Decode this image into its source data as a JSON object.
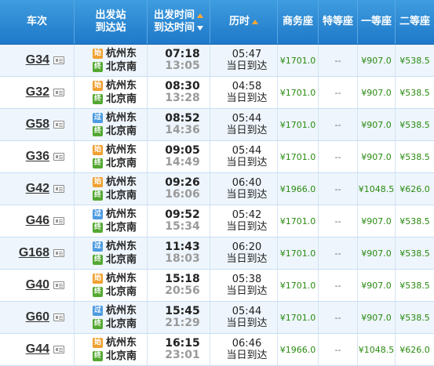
{
  "header": {
    "train": "车次",
    "station_top": "出发站",
    "station_bottom": "到达站",
    "time_top": "出发时间",
    "time_bottom": "到达时间",
    "duration": "历时",
    "business": "商务座",
    "special": "特等座",
    "first": "一等座",
    "second": "二等座"
  },
  "badge_labels": {
    "start": "始",
    "pass": "过",
    "end": "终"
  },
  "colors": {
    "header_blue": "#1e78c8",
    "price_green": "#2a8a12",
    "sort_arrow": "#ffa733"
  },
  "trains": [
    {
      "no": "G34",
      "from": "杭州东",
      "from_type": "start",
      "to": "北京南",
      "dep": "07:18",
      "arr": "13:05",
      "dur": "05:47",
      "day": "当日到达",
      "business": "¥1701.0",
      "special": "--",
      "first": "¥907.0",
      "second": "¥538.5"
    },
    {
      "no": "G32",
      "from": "杭州东",
      "from_type": "start",
      "to": "北京南",
      "dep": "08:30",
      "arr": "13:28",
      "dur": "04:58",
      "day": "当日到达",
      "business": "¥1701.0",
      "special": "--",
      "first": "¥907.0",
      "second": "¥538.5"
    },
    {
      "no": "G58",
      "from": "杭州东",
      "from_type": "pass",
      "to": "北京南",
      "dep": "08:52",
      "arr": "14:36",
      "dur": "05:44",
      "day": "当日到达",
      "business": "¥1701.0",
      "special": "--",
      "first": "¥907.0",
      "second": "¥538.5"
    },
    {
      "no": "G36",
      "from": "杭州东",
      "from_type": "start",
      "to": "北京南",
      "dep": "09:05",
      "arr": "14:49",
      "dur": "05:44",
      "day": "当日到达",
      "business": "¥1701.0",
      "special": "--",
      "first": "¥907.0",
      "second": "¥538.5"
    },
    {
      "no": "G42",
      "from": "杭州东",
      "from_type": "start",
      "to": "北京南",
      "dep": "09:26",
      "arr": "16:06",
      "dur": "06:40",
      "day": "当日到达",
      "business": "¥1966.0",
      "special": "--",
      "first": "¥1048.5",
      "second": "¥626.0"
    },
    {
      "no": "G46",
      "from": "杭州东",
      "from_type": "pass",
      "to": "北京南",
      "dep": "09:52",
      "arr": "15:34",
      "dur": "05:42",
      "day": "当日到达",
      "business": "¥1701.0",
      "special": "--",
      "first": "¥907.0",
      "second": "¥538.5"
    },
    {
      "no": "G168",
      "from": "杭州东",
      "from_type": "pass",
      "to": "北京南",
      "dep": "11:43",
      "arr": "18:03",
      "dur": "06:20",
      "day": "当日到达",
      "business": "¥1701.0",
      "special": "--",
      "first": "¥907.0",
      "second": "¥538.5"
    },
    {
      "no": "G40",
      "from": "杭州东",
      "from_type": "start",
      "to": "北京南",
      "dep": "15:18",
      "arr": "20:56",
      "dur": "05:38",
      "day": "当日到达",
      "business": "¥1701.0",
      "special": "--",
      "first": "¥907.0",
      "second": "¥538.5"
    },
    {
      "no": "G60",
      "from": "杭州东",
      "from_type": "pass",
      "to": "北京南",
      "dep": "15:45",
      "arr": "21:29",
      "dur": "05:44",
      "day": "当日到达",
      "business": "¥1701.0",
      "special": "--",
      "first": "¥907.0",
      "second": "¥538.5"
    },
    {
      "no": "G44",
      "from": "杭州东",
      "from_type": "start",
      "to": "北京南",
      "dep": "16:15",
      "arr": "23:01",
      "dur": "06:46",
      "day": "当日到达",
      "business": "¥1966.0",
      "special": "--",
      "first": "¥1048.5",
      "second": "¥626.0"
    }
  ]
}
